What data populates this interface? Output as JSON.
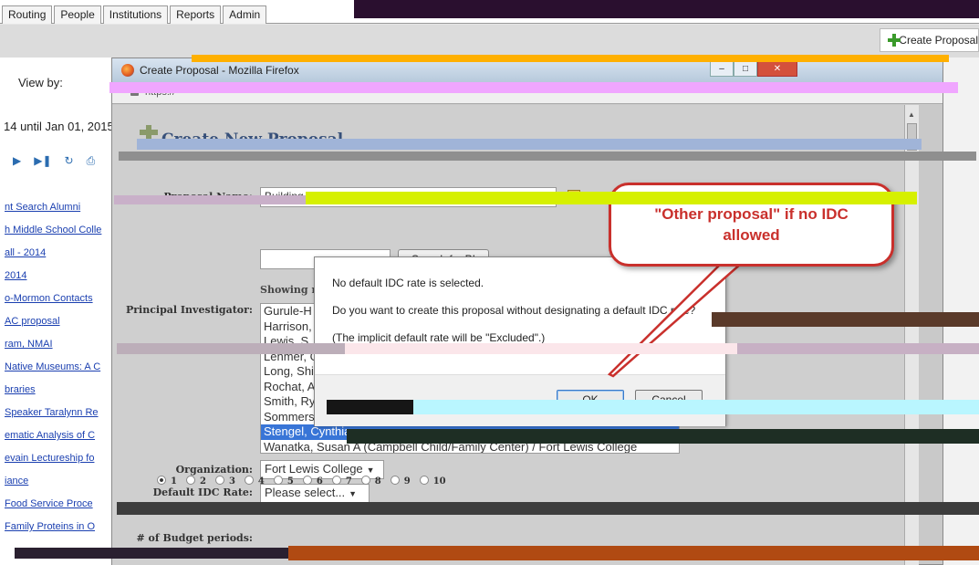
{
  "app": {
    "tabs": [
      "Routing",
      "People",
      "Institutions",
      "Reports",
      "Admin"
    ],
    "create_proposal_button": "Create Proposal",
    "view_by_label": "View by:",
    "date_range_text": "14 until Jan 01, 2015",
    "nav_icons": [
      "play-icon",
      "skip-end-icon",
      "refresh-icon",
      "print-icon"
    ],
    "proposal_list": [
      "nt Search Alumni",
      "h Middle School Colle",
      "all - 2014",
      "2014",
      "o-Mormon Contacts",
      "AC proposal",
      "ram, NMAI",
      "Native Museums: A C",
      "braries",
      "Speaker Taralynn Re",
      "ematic Analysis of C",
      "evain Lectureship fo",
      "iance",
      "Food Service Proce",
      "Family Proteins in O"
    ]
  },
  "popup": {
    "window_title": "Create Proposal - Mozilla Firefox",
    "url": "https://",
    "page_title": "Create New Proposal",
    "proposal_name_label": "Proposal Name:",
    "proposal_name_value": "Building Our Dream Project",
    "search_button": "Search for PI",
    "showing_text": "Showing results",
    "pi_label": "Principal Investigator:",
    "pi_options": [
      "Gurule-H",
      "Harrison,",
      "Lewis, S",
      "Lehmer, G",
      "Long, Shi",
      "Rochat, A",
      "Smith, Ry",
      "Sommers,",
      "Stengel, Cynthia",
      "Wanatka, Susan A (Campbell Child/Family Center) / Fort Lewis College"
    ],
    "pi_selected_index": 8,
    "organization_label": "Organization:",
    "organization_value": "Fort Lewis College",
    "idc_label": "Default IDC Rate:",
    "idc_value": "Please select...",
    "budget_label": "# of Budget periods:",
    "budget_options": [
      "1",
      "2",
      "3",
      "4",
      "5",
      "6",
      "7",
      "8",
      "9",
      "10"
    ],
    "budget_selected": "1"
  },
  "dialog": {
    "line1": "No default IDC rate is selected.",
    "line2": "Do you want to create this proposal without designating a default IDC rate?",
    "line3": "(The implicit default rate will be \"Excluded\".)",
    "ok": "OK",
    "cancel": "Cancel"
  },
  "callout": {
    "text": "\"Other proposal\" if no IDC allowed",
    "color": "#c9302c"
  }
}
